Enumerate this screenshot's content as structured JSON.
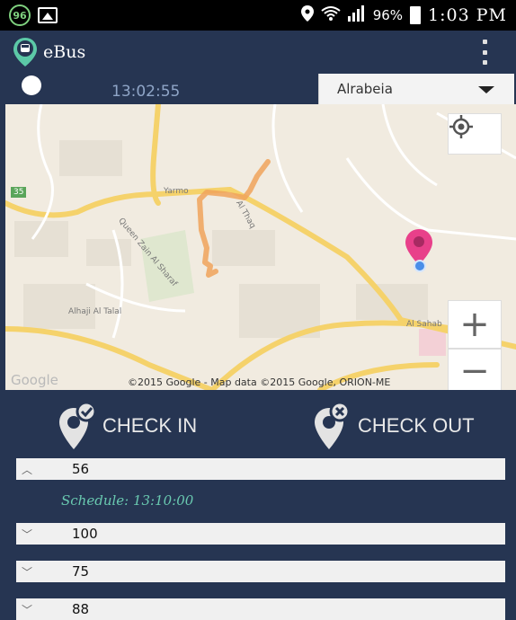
{
  "status_bar": {
    "badge": "96",
    "battery": "96%",
    "time": "1:03 PM"
  },
  "app": {
    "title": "eBus"
  },
  "info": {
    "clock": "13:02:55",
    "stop_selected": "Alrabeia"
  },
  "map": {
    "route_badge": "35",
    "attribution": "©2015 Google - Map data ©2015 Google, ORION-ME",
    "watermark": "Google",
    "labels": {
      "yarmouk": "Yarmo",
      "street_a": "Al Thaq",
      "street_b": "Queen Zain Al Sharaf",
      "street_c": "Alhaji Al Talal",
      "street_d": "Al Sahab"
    },
    "zoom_in": "+",
    "zoom_out": "−",
    "colors": {
      "route": "#f0a35a",
      "pin": "#e8408a",
      "position": "#4a8ee8"
    }
  },
  "actions": {
    "check_in": "CHECK IN",
    "check_out": "CHECK OUT"
  },
  "routes": [
    {
      "number": "56",
      "expanded": true
    },
    {
      "number": "100",
      "expanded": false
    },
    {
      "number": "75",
      "expanded": false
    },
    {
      "number": "88",
      "expanded": false
    }
  ],
  "schedule": "Schedule: 13:10:00"
}
